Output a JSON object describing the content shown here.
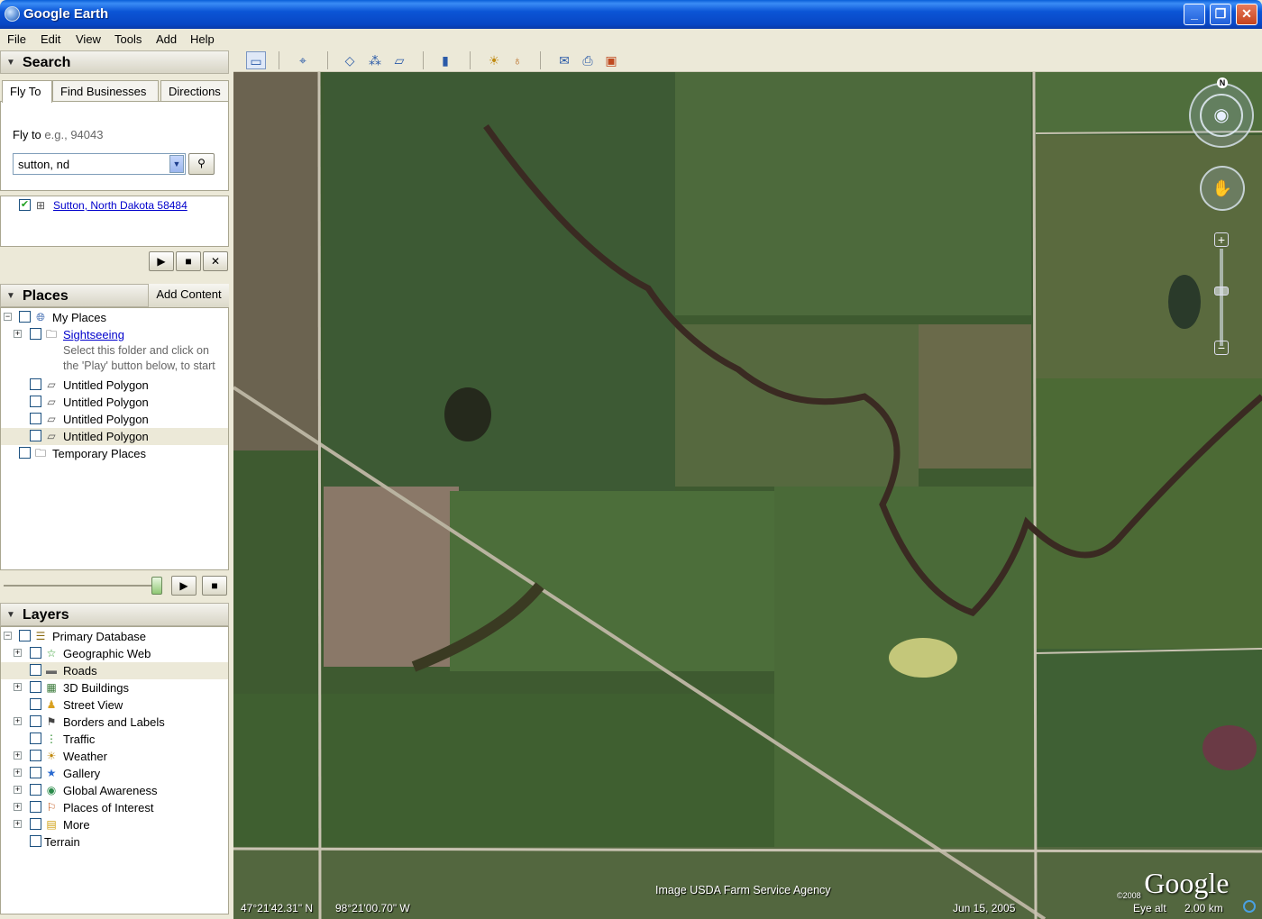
{
  "window": {
    "title": "Google Earth",
    "min": "_",
    "max": "❐",
    "close": "✕"
  },
  "menu": [
    "File",
    "Edit",
    "View",
    "Tools",
    "Add",
    "Help"
  ],
  "search": {
    "header": "Search",
    "tabs": [
      "Fly To",
      "Find Businesses",
      "Directions"
    ],
    "fly_label": "Fly to",
    "fly_hint": "e.g., 94043",
    "query": "sutton, nd",
    "result": "Sutton, North Dakota 58484"
  },
  "places": {
    "header": "Places",
    "add_content": "Add Content",
    "items": [
      {
        "label": "My Places"
      },
      {
        "label": "Sightseeing",
        "note1": "Select this folder and click on",
        "note2": "the 'Play' button below, to start"
      },
      {
        "label": "Untitled Polygon"
      },
      {
        "label": "Untitled Polygon"
      },
      {
        "label": "Untitled Polygon"
      },
      {
        "label": "Untitled Polygon"
      },
      {
        "label": "Temporary Places"
      }
    ]
  },
  "layers": {
    "header": "Layers",
    "items": [
      {
        "label": "Primary Database"
      },
      {
        "label": "Geographic Web"
      },
      {
        "label": "Roads"
      },
      {
        "label": "3D Buildings"
      },
      {
        "label": "Street View"
      },
      {
        "label": "Borders and Labels"
      },
      {
        "label": "Traffic"
      },
      {
        "label": "Weather"
      },
      {
        "label": "Gallery"
      },
      {
        "label": "Global Awareness"
      },
      {
        "label": "Places of Interest"
      },
      {
        "label": "More"
      },
      {
        "label": "Terrain"
      }
    ]
  },
  "map": {
    "compass_n": "N",
    "lat": "47°21'42.31\" N",
    "lon": "98°21'00.70\" W",
    "credit": "Image USDA Farm Service Agency",
    "date": "Jun 15, 2005",
    "eye_alt_label": "Eye alt",
    "eye_alt": "2.00 km",
    "logo_small": "©2008",
    "logo": "Google"
  }
}
